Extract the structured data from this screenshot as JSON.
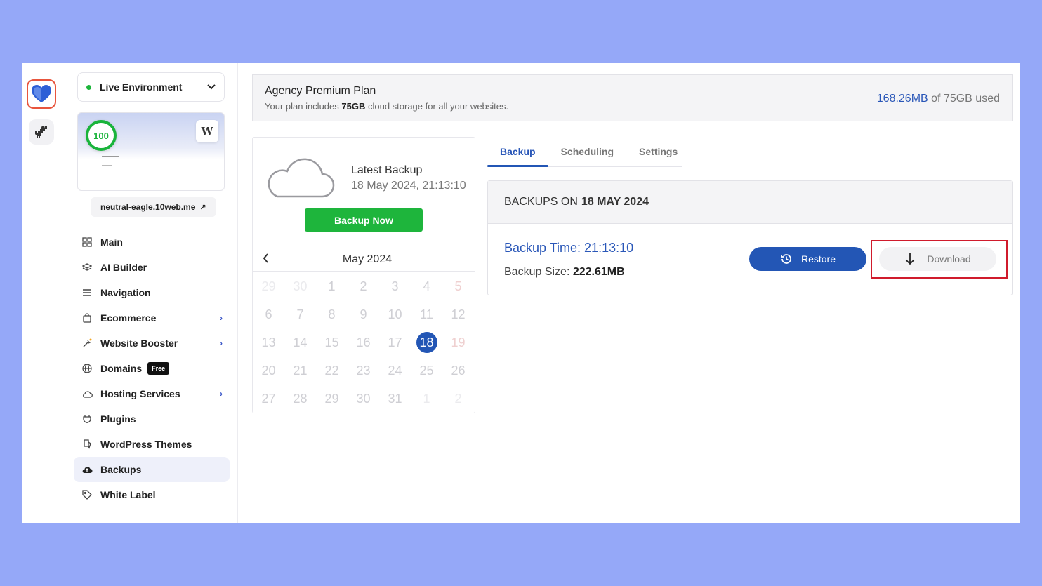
{
  "environment": {
    "label": "Live Environment"
  },
  "site": {
    "score": "100",
    "domain": "neutral-eagle.10web.me",
    "external_icon": "↗"
  },
  "nav": {
    "items": [
      {
        "label": "Main",
        "icon": "grid-icon"
      },
      {
        "label": "AI Builder",
        "icon": "layers-icon"
      },
      {
        "label": "Navigation",
        "icon": "menu-icon"
      },
      {
        "label": "Ecommerce",
        "icon": "bag-icon",
        "chevron": true
      },
      {
        "label": "Website Booster",
        "icon": "sparkle-icon",
        "chevron": true
      },
      {
        "label": "Domains",
        "icon": "globe-icon",
        "badge": "Free"
      },
      {
        "label": "Hosting Services",
        "icon": "cloud-icon",
        "chevron": true
      },
      {
        "label": "Plugins",
        "icon": "plug-icon"
      },
      {
        "label": "WordPress Themes",
        "icon": "brush-icon"
      },
      {
        "label": "Backups",
        "icon": "cloud-upload-icon",
        "active": true
      },
      {
        "label": "White Label",
        "icon": "tag-icon"
      }
    ]
  },
  "plan": {
    "title": "Agency Premium Plan",
    "sub_prefix": "Your plan includes ",
    "sub_amount": "75GB",
    "sub_suffix": " cloud storage for all your websites.",
    "used": "168.26MB",
    "of_total": " of 75GB used"
  },
  "latest": {
    "title": "Latest Backup",
    "date": "18 May 2024, 21:13:10",
    "button": "Backup Now"
  },
  "calendar": {
    "month": "May 2024",
    "prev_icon": "<",
    "selected": "18",
    "weeks": [
      [
        "29",
        "30",
        "1",
        "2",
        "3",
        "4",
        "5"
      ],
      [
        "6",
        "7",
        "8",
        "9",
        "10",
        "11",
        "12"
      ],
      [
        "13",
        "14",
        "15",
        "16",
        "17",
        "18",
        "19"
      ],
      [
        "20",
        "21",
        "22",
        "23",
        "24",
        "25",
        "26"
      ],
      [
        "27",
        "28",
        "29",
        "30",
        "31",
        "1",
        "2"
      ]
    ]
  },
  "tabs": [
    {
      "label": "Backup",
      "active": true
    },
    {
      "label": "Scheduling"
    },
    {
      "label": "Settings"
    }
  ],
  "backups": {
    "heading_prefix": "BACKUPS ON",
    "heading_date": "18 MAY 2024",
    "time_label": "Backup Time: 21:13:10",
    "size_prefix": "Backup Size: ",
    "size_value": "222.61MB",
    "restore": "Restore",
    "download": "Download"
  },
  "colors": {
    "accent": "#2356b5",
    "success": "#1eb53c",
    "highlight": "#d01b2c"
  }
}
